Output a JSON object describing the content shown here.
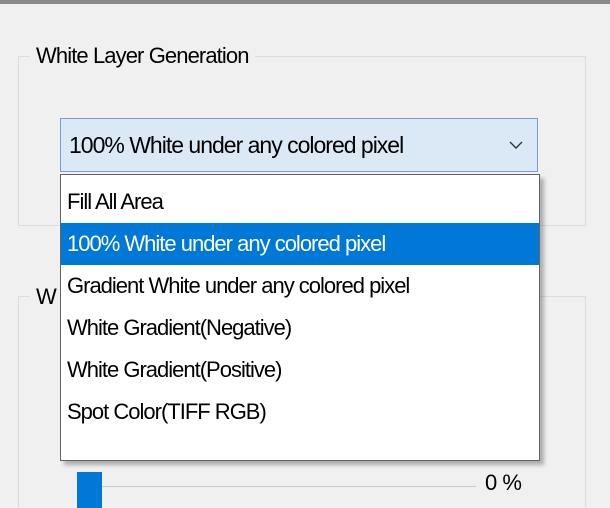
{
  "white_layer_generation": {
    "title": "White Layer Generation",
    "selected_value": "100% White under any colored pixel",
    "options": [
      "Fill All Area",
      "100% White under any colored pixel",
      "Gradient White under any colored pixel",
      "White Gradient(Negative)",
      "White Gradient(Positive)",
      "Spot Color(TIFF RGB)"
    ],
    "selected_index": 1
  },
  "second_group": {
    "title_fragment": "W"
  },
  "slider": {
    "value_text": "0 %",
    "level_percent": 0
  },
  "icons": {
    "combo_arrow": "chevron-down-icon"
  },
  "colors": {
    "selection": "#0078d7",
    "dialog_background": "#f0f0f0",
    "combo_background": "#dbe8f6",
    "combo_border": "#7a9bd6"
  }
}
